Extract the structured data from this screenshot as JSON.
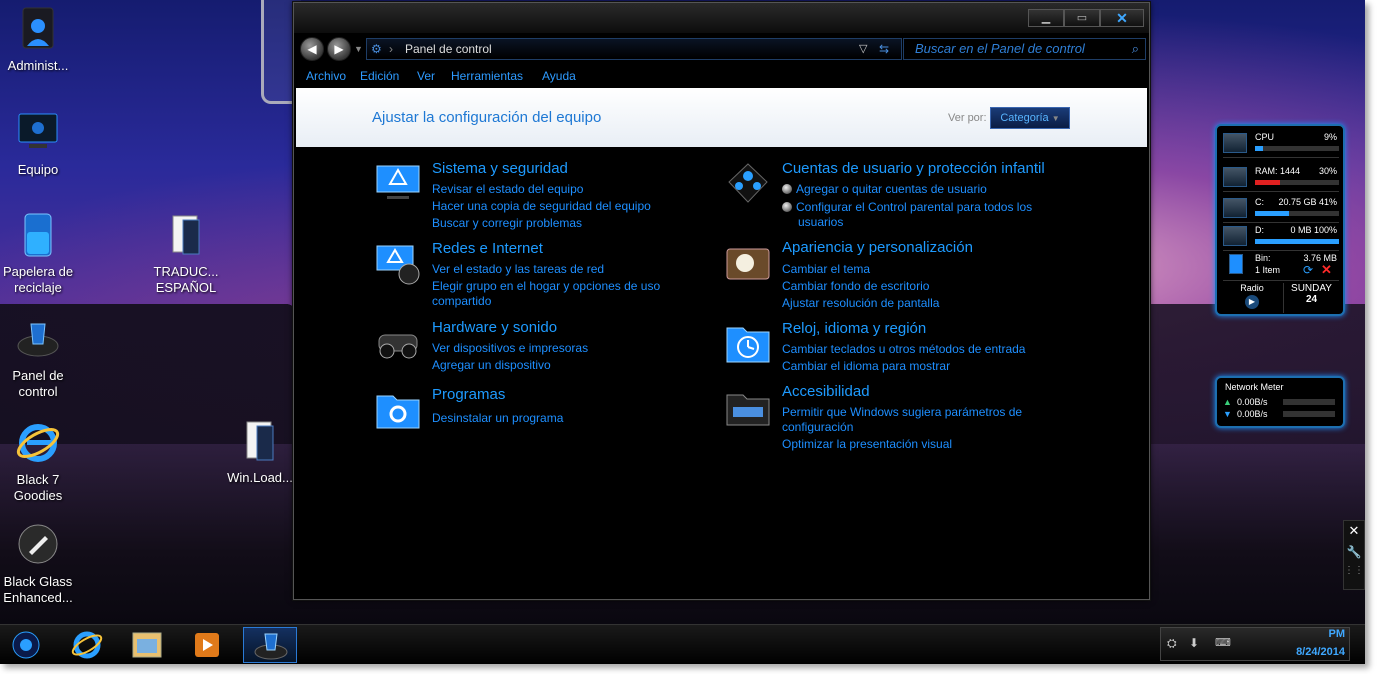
{
  "desktop": {
    "icons_left": [
      {
        "label": "Administ...",
        "icon": "user-folder-icon"
      },
      {
        "label": "Equipo",
        "icon": "computer-icon"
      },
      {
        "label": "Papelera de reciclaje",
        "icon": "recycle-bin-icon"
      },
      {
        "label": "Panel de control",
        "icon": "control-panel-icon"
      },
      {
        "label": "Black 7 Goodies",
        "icon": "internet-explorer-icon"
      },
      {
        "label": "Black Glass Enhanced...",
        "icon": "brush-icon"
      }
    ],
    "icons_mid": [
      {
        "label": "TRADUC... ESPAÑOL",
        "icon": "document-icon"
      },
      {
        "label": "Win.Load...",
        "icon": "document-icon"
      }
    ]
  },
  "window": {
    "address": {
      "path": "Panel de control"
    },
    "search": {
      "placeholder": "Buscar en el Panel de control"
    },
    "menu": [
      "Archivo",
      "Edición",
      "Ver",
      "Herramientas",
      "Ayuda"
    ],
    "header": {
      "title": "Ajustar la configuración del equipo",
      "view_by_label": "Ver por:",
      "view_by_value": "Categoría"
    },
    "categories": [
      {
        "title": "Sistema y seguridad",
        "icon": "system-security-icon",
        "links": [
          "Revisar el estado del equipo",
          "Hacer una copia de seguridad del equipo",
          "Buscar y corregir problemas"
        ]
      },
      {
        "title": "Redes e Internet",
        "icon": "network-icon",
        "links": [
          "Ver el estado y las tareas de red",
          "Elegir grupo en el hogar y opciones de uso",
          "compartido"
        ]
      },
      {
        "title": "Hardware y sonido",
        "icon": "hardware-sound-icon",
        "links": [
          "Ver dispositivos e impresoras",
          "Agregar un dispositivo"
        ]
      },
      {
        "title": "Programas",
        "icon": "programs-icon",
        "links": [
          "Desinstalar un programa"
        ]
      },
      {
        "title": "Cuentas de usuario y protección infantil",
        "icon": "user-accounts-icon",
        "links": [
          "Agregar o quitar cuentas de usuario",
          "Configurar el Control parental para todos los",
          "usuarios"
        ]
      },
      {
        "title": "Apariencia y personalización",
        "icon": "appearance-icon",
        "links": [
          "Cambiar el tema",
          "Cambiar fondo de escritorio",
          "Ajustar resolución de pantalla"
        ]
      },
      {
        "title": "Reloj, idioma y región",
        "icon": "clock-region-icon",
        "links": [
          "Cambiar teclados u otros métodos de entrada",
          "Cambiar el idioma para mostrar"
        ]
      },
      {
        "title": "Accesibilidad",
        "icon": "accessibility-icon",
        "links": [
          "Permitir que Windows sugiera parámetros de",
          "configuración",
          "Optimizar la presentación visual"
        ]
      }
    ]
  },
  "gadget": {
    "cpu": {
      "label": "CPU",
      "value": "9%",
      "level": 0.09
    },
    "ram": {
      "label": "RAM: 1444",
      "value": "30%",
      "level": 0.3
    },
    "c": {
      "label": "C:",
      "value": "20.75 GB 41%",
      "level": 0.41
    },
    "d": {
      "label": "D:",
      "value": "0 MB 100%",
      "level": 1.0
    },
    "bin": {
      "label": "Bin:",
      "value": "3.76 MB",
      "items": "1 Item"
    },
    "radio": "Radio",
    "day": "SUNDAY",
    "date": "24"
  },
  "network": {
    "title": "Network Meter",
    "up": "0.00B/s",
    "down": "0.00B/s"
  },
  "taskbar": {
    "time": "PM",
    "date": "8/24/2014"
  },
  "colors": {
    "accent": "#1e8fff",
    "window_bg": "#000000"
  }
}
